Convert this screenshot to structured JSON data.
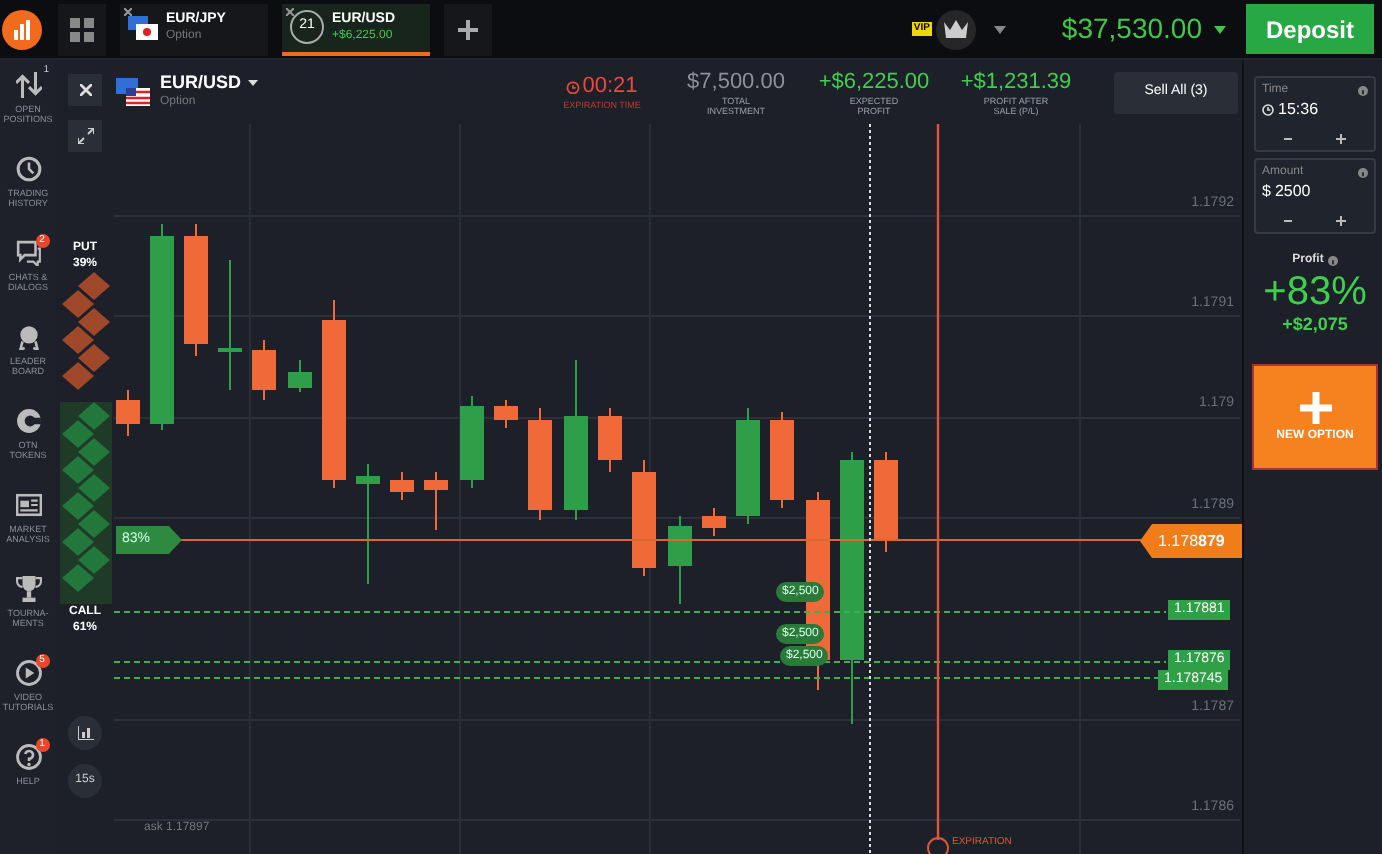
{
  "top_bar": {
    "tabs": [
      {
        "kind": "flag",
        "pair": "EUR/JPY",
        "subtitle": "Option",
        "selected": false
      },
      {
        "kind": "timer",
        "timer": "21",
        "pair": "EUR/USD",
        "subtitle": "+$6,225.00",
        "selected": true
      }
    ],
    "vip_badge": "VIP",
    "balance": "$37,530.00",
    "deposit_button": "Deposit"
  },
  "sidebar": {
    "items": [
      {
        "label": "OPEN POSITIONS",
        "badge": {
          "text": "1",
          "kind": "plain"
        }
      },
      {
        "label": "TRADING HISTORY"
      },
      {
        "label": "CHATS & DIALOGS",
        "badge": {
          "text": "2",
          "kind": "alert"
        }
      },
      {
        "label": "LEADER BOARD"
      },
      {
        "label": "OTN TOKENS"
      },
      {
        "label": "MARKET ANALYSIS"
      },
      {
        "label": "TOURNA-MENTS"
      },
      {
        "label": "VIDEO TUTORIALS",
        "badge": {
          "text": "5",
          "kind": "alert"
        }
      },
      {
        "label": "HELP",
        "badge": {
          "text": "1",
          "kind": "alert"
        }
      }
    ]
  },
  "chart_header": {
    "asset": "EUR/USD",
    "asset_type": "Option",
    "stats": [
      {
        "kind": "timer",
        "value": "00:21",
        "label": "EXPIRATION TIME"
      },
      {
        "kind": "neutral",
        "value": "$7,500.00",
        "label": "TOTAL INVESTMENT"
      },
      {
        "kind": "profit",
        "value": "+$6,225.00",
        "label": "EXPECTED PROFIT"
      },
      {
        "kind": "profit",
        "value": "+$1,231.39",
        "label": "PROFIT AFTER SALE (P/L)"
      }
    ],
    "sell_all_button": "Sell All (3)"
  },
  "sentiment": {
    "put_label": "PUT",
    "put_percent": "39%",
    "call_label": "CALL",
    "call_percent": "61%",
    "level": 0.39
  },
  "chart": {
    "price_labels": [
      "1.1792",
      "1.1791",
      "1.179",
      "1.1789",
      "1.1787",
      "1.1786"
    ],
    "current_price": "1.178**879**",
    "payout_tag": "83%",
    "deal_prices": [
      "1.17881",
      "1.17876",
      "1.178745"
    ],
    "deal_amounts": [
      "$2,500",
      "$2,500",
      "$2,500"
    ],
    "ask": "ask 1.17897",
    "expiration_label": "EXPIRATION",
    "interval_button": "15s"
  },
  "right_panel": {
    "time": {
      "label": "Time",
      "value": "15:36"
    },
    "amount": {
      "label": "Amount",
      "currency": "$",
      "value": "2500"
    },
    "profit": {
      "label": "Profit",
      "percent": "+83%",
      "amount": "+$2,075"
    },
    "new_option_button": "NEW OPTION"
  }
}
